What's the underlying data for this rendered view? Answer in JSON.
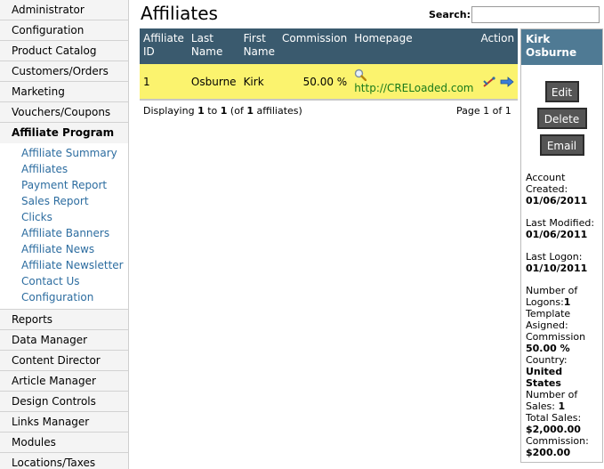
{
  "sidebar": {
    "items_top": [
      "Administrator",
      "Configuration",
      "Product Catalog",
      "Customers/Orders",
      "Marketing",
      "Vouchers/Coupons"
    ],
    "active": "Affiliate Program",
    "sub_items": [
      "Affiliate Summary",
      "Affiliates",
      "Payment Report",
      "Sales Report",
      "Clicks",
      "Affiliate Banners",
      "Affiliate News",
      "Affiliate Newsletter",
      "Contact Us",
      "Configuration"
    ],
    "items_bottom": [
      "Reports",
      "Data Manager",
      "Content Director",
      "Article Manager",
      "Design Controls",
      "Links Manager",
      "Modules",
      "Locations/Taxes"
    ]
  },
  "main": {
    "title": "Affiliates",
    "search_label": "Search:",
    "search_value": "",
    "table": {
      "headers": {
        "id": "Affiliate ID",
        "last": "Last Name",
        "first": "First Name",
        "commission": "Commission",
        "homepage": "Homepage",
        "action": "Action"
      },
      "rows": [
        {
          "id": "1",
          "last": "Osburne",
          "first": "Kirk",
          "commission": "50.00 %",
          "homepage": "http://CRELoaded.com"
        }
      ]
    },
    "footer": {
      "displaying_prefix": "Displaying",
      "from": "1",
      "to_word": "to",
      "to": "1",
      "of_open": "(of",
      "total": "1",
      "of_close": "affiliates)",
      "page_label": "Page 1 of 1"
    }
  },
  "panel": {
    "name": "Kirk Osburne",
    "buttons": {
      "edit": "Edit",
      "delete": "Delete",
      "email": "Email"
    },
    "account_created_label": "Account Created:",
    "account_created": "01/06/2011",
    "last_modified_label": "Last Modified:",
    "last_modified": "01/06/2011",
    "last_logon_label": "Last Logon:",
    "last_logon": "01/10/2011",
    "logons_label": "Number of Logons:",
    "logons": "1",
    "template_label": "Template Asigned:",
    "commission_label": "Commission",
    "commission": "50.00 %",
    "country_label": "Country:",
    "country": "United States",
    "sales_label": "Number of Sales:",
    "sales": "1",
    "total_sales_label": "Total Sales:",
    "total_sales": "$2,000.00",
    "commission_total_label": "Commission:",
    "commission_total": "$200.00"
  },
  "colors": {
    "header_bg": "#3a5a6e",
    "panel_head_bg": "#4f7a94",
    "row_highlight": "#fbf36e",
    "link": "#2d6da0",
    "homepage_link": "#1a7a1a"
  },
  "icons": {
    "preview": "magnifier-icon",
    "edit": "edit-pencil-icon",
    "go": "arrow-right-icon"
  }
}
